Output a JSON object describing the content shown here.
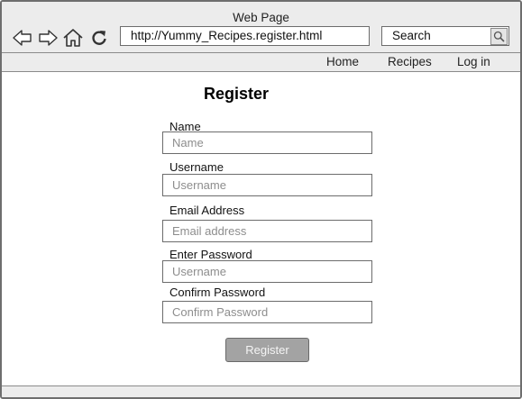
{
  "browser": {
    "window_title": "Web Page",
    "url": "http://Yummy_Recipes.register.html",
    "search_label": "Search",
    "nav_icons": [
      "back-arrow-icon",
      "forward-arrow-icon",
      "home-icon",
      "reload-icon"
    ]
  },
  "menu": {
    "items": [
      {
        "label": "Home"
      },
      {
        "label": "Recipes"
      },
      {
        "label": "Log in"
      }
    ]
  },
  "form": {
    "title": "Register",
    "fields": [
      {
        "label": "Name",
        "placeholder": "Name",
        "value": ""
      },
      {
        "label": "Username",
        "placeholder": "Username",
        "value": ""
      },
      {
        "label": "Email Address",
        "placeholder": "Email address",
        "value": ""
      },
      {
        "label": "Enter Password",
        "placeholder": "Username",
        "value": ""
      },
      {
        "label": "Confirm Password",
        "placeholder": "Confirm Password",
        "value": ""
      }
    ],
    "submit_label": "Register"
  },
  "colors": {
    "chrome_bg": "#ececec",
    "button_bg": "#a3a3a3",
    "border": "#6c6c6c"
  }
}
